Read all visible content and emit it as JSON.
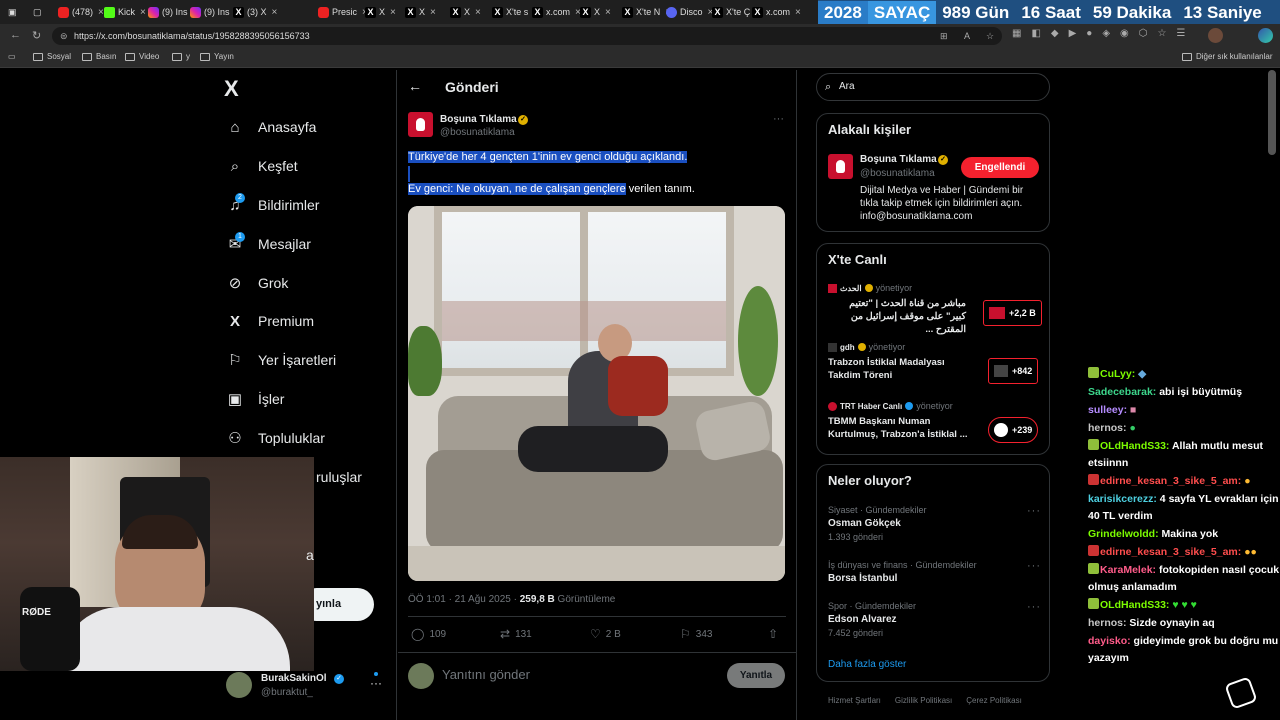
{
  "browser": {
    "tabs": [
      {
        "label": "(478)",
        "icon": "youtube"
      },
      {
        "label": "Kick",
        "icon": "kick"
      },
      {
        "label": "(9) Ins",
        "icon": "instagram"
      },
      {
        "label": "(9) Ins",
        "icon": "instagram"
      },
      {
        "label": "(3) X",
        "icon": "x"
      },
      {
        "label": "Presic",
        "icon": "youtube"
      },
      {
        "label": "X",
        "icon": "x"
      },
      {
        "label": "X",
        "icon": "x"
      },
      {
        "label": "X",
        "icon": "x"
      },
      {
        "label": "X'te s",
        "icon": "x"
      },
      {
        "label": "x.com",
        "icon": "x"
      },
      {
        "label": "X",
        "icon": "x"
      },
      {
        "label": "X'te N",
        "icon": "x"
      },
      {
        "label": "Disco",
        "icon": "discord"
      },
      {
        "label": "X'te Ç",
        "icon": "x"
      },
      {
        "label": "x.com",
        "icon": "x"
      }
    ],
    "url": "https://x.com/bosunatiklama/status/1958288395056156733",
    "bookmarks": [
      "Sosyal",
      "Basın",
      "Video",
      "y",
      "Yayın"
    ],
    "other_bookmarks": "Diğer sık kullanılanlar"
  },
  "overlay_counter": {
    "year": "2028",
    "label": "SAYAÇ",
    "days": "989 Gün",
    "hours": "16 Saat",
    "minutes": "59 Dakika",
    "seconds": "13 Saniye"
  },
  "sidebar": {
    "logo": "X",
    "items": [
      {
        "label": "Anasayfa",
        "icon": "home-icon"
      },
      {
        "label": "Keşfet",
        "icon": "search-icon"
      },
      {
        "label": "Bildirimler",
        "icon": "bell-icon",
        "badge": "2"
      },
      {
        "label": "Mesajlar",
        "icon": "mail-icon",
        "badge": "1"
      },
      {
        "label": "Grok",
        "icon": "grok-icon"
      },
      {
        "label": "Premium",
        "icon": "x-icon"
      },
      {
        "label": "Yer İşaretleri",
        "icon": "bookmark-icon"
      },
      {
        "label": "İşler",
        "icon": "briefcase-icon"
      },
      {
        "label": "Topluluklar",
        "icon": "people-icon"
      },
      {
        "label": "ruluşlar",
        "icon": ""
      },
      {
        "label": "a",
        "icon": ""
      }
    ],
    "post_button": "yınla",
    "account": {
      "name": "BurakSakinOl",
      "handle": "@buraktut_"
    }
  },
  "tweet_page": {
    "header": "Gönderi",
    "author": {
      "name": "Boşuna Tıklama",
      "handle": "@bosunatiklama"
    },
    "text_line1": "Türkiye'de her 4 gençten 1'inin ev genci olduğu açıklandı.",
    "text_line2_selected": "Ev genci: Ne okuyan, ne de çalışan gençlere",
    "text_line2_rest": " verilen tanım.",
    "meta": {
      "time": "ÖÖ 1:01 · 21 Ağu 2025 · ",
      "views": "259,8 B",
      "views_label": " Görüntüleme"
    },
    "actions": {
      "replies": "109",
      "reposts": "131",
      "likes": "2 B",
      "bookmarks": "343"
    },
    "reply_placeholder": "Yanıtını gönder",
    "reply_button": "Yanıtla"
  },
  "right": {
    "search_placeholder": "Ara",
    "related": {
      "title": "Alakalı kişiler",
      "name": "Boşuna Tıklama",
      "handle": "@bosunatiklama",
      "bio": "Dijital Medya ve Haber | Gündemi bir tıkla takip etmek için bildirimleri açın. info@bosunatiklama.com",
      "button": "Engellendi"
    },
    "live": {
      "title": "X'te Canlı",
      "items": [
        {
          "host": "الحدث",
          "role": "yönetiyor",
          "title": "مباشر من قناة الحدث | \"تعتيم كبير\" على موقف إسرائيل من المقترح ...",
          "count": "+2,2 B"
        },
        {
          "host": "gdh",
          "role": "yönetiyor",
          "title": "Trabzon İstiklal Madalyası Takdim Töreni",
          "count": "+842"
        },
        {
          "host": "TRT Haber Canlı",
          "role": "yönetiyor",
          "title": "TBMM Başkanı Numan Kurtulmuş, Trabzon'a İstiklal ...",
          "count": "+239"
        }
      ]
    },
    "trends": {
      "title": "Neler oluyor?",
      "items": [
        {
          "context": "Siyaset · Gündemdekiler",
          "name": "Osman Gökçek",
          "posts": "1.393 gönderi"
        },
        {
          "context": "İş dünyası ve finans · Gündemdekiler",
          "name": "Borsa İstanbul",
          "posts": ""
        },
        {
          "context": "Spor · Gündemdekiler",
          "name": "Edson Alvarez",
          "posts": "7.452 gönderi"
        }
      ],
      "more": "Daha fazla göster"
    },
    "footer": [
      "Hizmet Şartları",
      "Gizlilik Politikası",
      "Çerez Politikası"
    ]
  },
  "chat": [
    {
      "user": "CuLyy:",
      "msg": "",
      "color": "#7cfc00"
    },
    {
      "user": "Sadecebarak:",
      "msg": " abi işi büyütmüş",
      "color": "#3dd68c"
    },
    {
      "user": "sulleey:",
      "msg": "",
      "color": "#b58cff"
    },
    {
      "user": "hernos:",
      "msg": "",
      "color": "#c7c7c7"
    },
    {
      "user": "OLdHandS33:",
      "msg": " Allah mutlu mesut etsiinnn",
      "color": "#7cfc00"
    },
    {
      "user": "edirne_kesan_3_sike_5_am:",
      "msg": "",
      "color": "#ff4d4d"
    },
    {
      "user": "karisikcerezz:",
      "msg": " 4 sayfa YL evrakları için 40 TL verdim",
      "color": "#4dd0e1"
    },
    {
      "user": "Grindelwoldd:",
      "msg": " Makina yok",
      "color": "#7cfc00"
    },
    {
      "user": "edirne_kesan_3_sike_5_am:",
      "msg": "",
      "color": "#ff4d4d"
    },
    {
      "user": "KaraMelek:",
      "msg": " fotokopiden nasıl çocuk olmuş anlamadım",
      "color": "#ff5c8a"
    },
    {
      "user": "OLdHandS33:",
      "msg": "",
      "color": "#7cfc00"
    },
    {
      "user": "hernos:",
      "msg": " Sizde  oynayin aq",
      "color": "#c7c7c7"
    },
    {
      "user": "dayisko:",
      "msg": " gideyimde grok bu doğru mu yazayım",
      "color": "#ff5c8a"
    }
  ],
  "colors": {
    "accent": "#1d9bf0",
    "selection": "#1a4fc0",
    "block_red": "#f4212e"
  }
}
